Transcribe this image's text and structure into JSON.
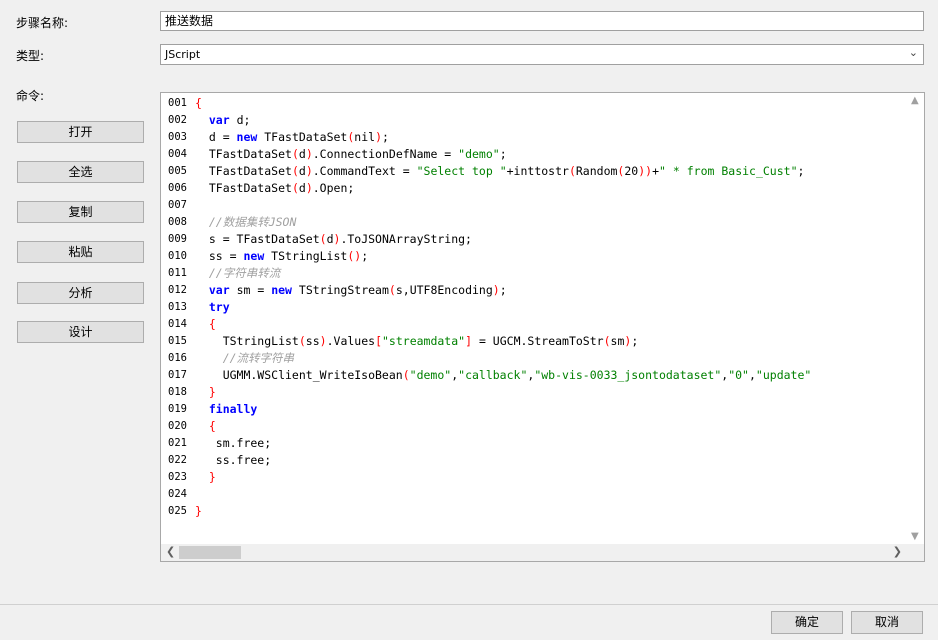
{
  "form": {
    "step_name_label": "步骤名称:",
    "step_name_value": "推送数据",
    "type_label": "类型:",
    "type_value": "JScript",
    "command_label": "命令:"
  },
  "buttons": {
    "open": "打开",
    "select_all": "全选",
    "copy": "复制",
    "paste": "粘贴",
    "analyze": "分析",
    "design": "设计",
    "ok": "确定",
    "cancel": "取消"
  },
  "colors": {
    "keyword": "#0000ff",
    "string": "#008000",
    "comment": "#a0a0a0",
    "bracket": "#ff0000",
    "text": "#000000"
  },
  "code_lines": [
    [
      [
        "{",
        "b"
      ]
    ],
    [
      [
        "  ",
        "t"
      ],
      [
        "var",
        "k"
      ],
      [
        " d;",
        "t"
      ]
    ],
    [
      [
        "  d = ",
        "t"
      ],
      [
        "new",
        "k"
      ],
      [
        " TFastDataSet",
        "t"
      ],
      [
        "(",
        "b"
      ],
      [
        "nil",
        "t"
      ],
      [
        ")",
        "b"
      ],
      [
        ";",
        "t"
      ]
    ],
    [
      [
        "  TFastDataSet",
        "t"
      ],
      [
        "(",
        "b"
      ],
      [
        "d",
        "t"
      ],
      [
        ")",
        "b"
      ],
      [
        ".ConnectionDefName = ",
        "t"
      ],
      [
        "\"demo\"",
        "s"
      ],
      [
        ";",
        "t"
      ]
    ],
    [
      [
        "  TFastDataSet",
        "t"
      ],
      [
        "(",
        "b"
      ],
      [
        "d",
        "t"
      ],
      [
        ")",
        "b"
      ],
      [
        ".CommandText = ",
        "t"
      ],
      [
        "\"Select top \"",
        "s"
      ],
      [
        "+inttostr",
        "t"
      ],
      [
        "(",
        "b"
      ],
      [
        "Random",
        "t"
      ],
      [
        "(",
        "b"
      ],
      [
        "20",
        "t"
      ],
      [
        ")",
        "b"
      ],
      [
        ")",
        "b"
      ],
      [
        "+",
        "t"
      ],
      [
        "\" * from Basic_Cust\"",
        "s"
      ],
      [
        ";",
        "t"
      ]
    ],
    [
      [
        "  TFastDataSet",
        "t"
      ],
      [
        "(",
        "b"
      ],
      [
        "d",
        "t"
      ],
      [
        ")",
        "b"
      ],
      [
        ".Open;",
        "t"
      ]
    ],
    [],
    [
      [
        "  ",
        "t"
      ],
      [
        "//数据集转JSON",
        "c"
      ]
    ],
    [
      [
        "  s = TFastDataSet",
        "t"
      ],
      [
        "(",
        "b"
      ],
      [
        "d",
        "t"
      ],
      [
        ")",
        "b"
      ],
      [
        ".ToJSONArrayString;",
        "t"
      ]
    ],
    [
      [
        "  ss = ",
        "t"
      ],
      [
        "new",
        "k"
      ],
      [
        " TStringList",
        "t"
      ],
      [
        "()",
        "b"
      ],
      [
        ";",
        "t"
      ]
    ],
    [
      [
        "  ",
        "t"
      ],
      [
        "//字符串转流",
        "c"
      ]
    ],
    [
      [
        "  ",
        "t"
      ],
      [
        "var",
        "k"
      ],
      [
        " sm = ",
        "t"
      ],
      [
        "new",
        "k"
      ],
      [
        " TStringStream",
        "t"
      ],
      [
        "(",
        "b"
      ],
      [
        "s,UTF8Encoding",
        "t"
      ],
      [
        ")",
        "b"
      ],
      [
        ";",
        "t"
      ]
    ],
    [
      [
        "  ",
        "t"
      ],
      [
        "try",
        "k"
      ]
    ],
    [
      [
        "  ",
        "t"
      ],
      [
        "{",
        "b"
      ]
    ],
    [
      [
        "    TStringList",
        "t"
      ],
      [
        "(",
        "b"
      ],
      [
        "ss",
        "t"
      ],
      [
        ")",
        "b"
      ],
      [
        ".Values",
        "t"
      ],
      [
        "[",
        "b"
      ],
      [
        "\"streamdata\"",
        "s"
      ],
      [
        "]",
        "b"
      ],
      [
        " = UGCM.StreamToStr",
        "t"
      ],
      [
        "(",
        "b"
      ],
      [
        "sm",
        "t"
      ],
      [
        ")",
        "b"
      ],
      [
        ";",
        "t"
      ]
    ],
    [
      [
        "    ",
        "t"
      ],
      [
        "//流转字符串",
        "c"
      ]
    ],
    [
      [
        "    UGMM.WSClient_WriteIsoBean",
        "t"
      ],
      [
        "(",
        "b"
      ],
      [
        "\"demo\"",
        "s"
      ],
      [
        ",",
        "t"
      ],
      [
        "\"callback\"",
        "s"
      ],
      [
        ",",
        "t"
      ],
      [
        "\"wb-vis-0033_jsontodataset\"",
        "s"
      ],
      [
        ",",
        "t"
      ],
      [
        "\"0\"",
        "s"
      ],
      [
        ",",
        "t"
      ],
      [
        "\"update\"",
        "s"
      ]
    ],
    [
      [
        "  ",
        "t"
      ],
      [
        "}",
        "b"
      ]
    ],
    [
      [
        "  ",
        "t"
      ],
      [
        "finally",
        "k"
      ]
    ],
    [
      [
        "  ",
        "t"
      ],
      [
        "{",
        "b"
      ]
    ],
    [
      [
        "   sm.free;",
        "t"
      ]
    ],
    [
      [
        "   ss.free;",
        "t"
      ]
    ],
    [
      [
        "  ",
        "t"
      ],
      [
        "}",
        "b"
      ]
    ],
    [],
    [
      [
        "}",
        "b"
      ]
    ]
  ],
  "line_numbers": [
    "001",
    "002",
    "003",
    "004",
    "005",
    "006",
    "007",
    "008",
    "009",
    "010",
    "011",
    "012",
    "013",
    "014",
    "015",
    "016",
    "017",
    "018",
    "019",
    "020",
    "021",
    "022",
    "023",
    "024",
    "025"
  ]
}
